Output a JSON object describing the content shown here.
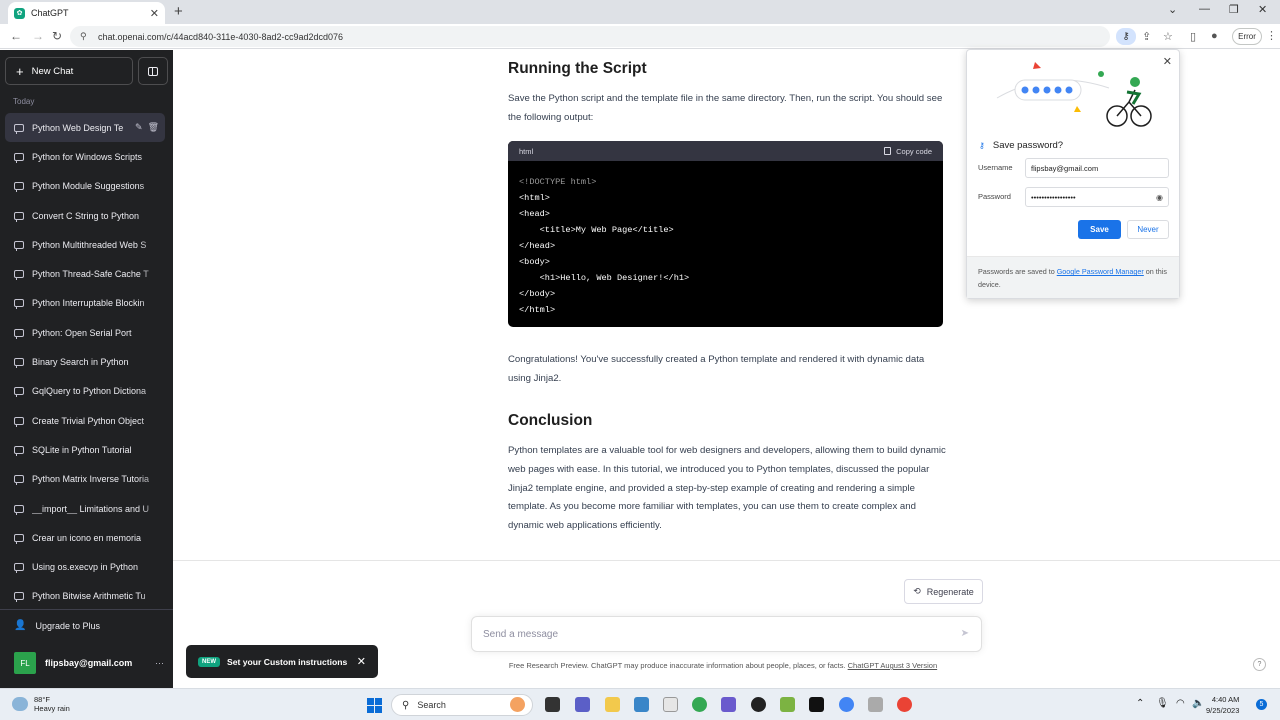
{
  "browser": {
    "tab_title": "ChatGPT",
    "url": "chat.openai.com/c/44acd840-311e-4030-8ad2-cc9ad2dcd076",
    "error_label": "Error"
  },
  "sidebar": {
    "new_chat": "New Chat",
    "section_today": "Today",
    "items": [
      {
        "label": "Python Web Design Te"
      },
      {
        "label": "Python for Windows Scripts"
      },
      {
        "label": "Python Module Suggestions"
      },
      {
        "label": "Convert C String to Python"
      },
      {
        "label": "Python Multithreaded Web S"
      },
      {
        "label": "Python Thread-Safe Cache T"
      },
      {
        "label": "Python Interruptable Blockin"
      },
      {
        "label": "Python: Open Serial Port"
      },
      {
        "label": "Binary Search in Python"
      },
      {
        "label": "GqlQuery to Python Dictiona"
      },
      {
        "label": "Create Trivial Python Object"
      },
      {
        "label": "SQLite in Python Tutorial"
      },
      {
        "label": "Python Matrix Inverse Tutoria"
      },
      {
        "label": "__import__ Limitations and U"
      },
      {
        "label": "Crear un icono en memoria"
      },
      {
        "label": "Using os.execvp in Python"
      },
      {
        "label": "Python Bitwise Arithmetic Tu"
      }
    ],
    "upgrade": "Upgrade to Plus",
    "account_initials": "FL",
    "account_email": "flipsbay@gmail.com"
  },
  "content": {
    "heading_running": "Running the Script",
    "para_running": "Save the Python script and the template file in the same directory. Then, run the script. You should see the following output:",
    "code_lang": "html",
    "copy_code": "Copy code",
    "code_lines": [
      "<!DOCTYPE html>",
      "<html>",
      "<head>",
      "    <title>My Web Page</title>",
      "</head>",
      "<body>",
      "    <h1>Hello, Web Designer!</h1>",
      "</body>",
      "</html>"
    ],
    "para_congrats": "Congratulations! You've successfully created a Python template and rendered it with dynamic data using Jinja2.",
    "heading_conclusion": "Conclusion",
    "para_conclusion": "Python templates are a valuable tool for web designers and developers, allowing them to build dynamic web pages with ease. In this tutorial, we introduced you to Python templates, discussed the popular Jinja2 template engine, and provided a step-by-step example of creating and rendering a simple template. As you become more familiar with templates, you can use them to create complex and dynamic web applications efficiently."
  },
  "composer": {
    "regenerate": "Regenerate",
    "placeholder": "Send a message",
    "disclaimer": "Free Research Preview. ChatGPT may produce inaccurate information about people, places, or facts.",
    "version_link": "ChatGPT August 3 Version",
    "help": "?"
  },
  "toast": {
    "badge": "NEW",
    "text": "Set your Custom instructions"
  },
  "password_popup": {
    "title": "Save password?",
    "username_label": "Username",
    "username_value": "flipsbay@gmail.com",
    "password_label": "Password",
    "password_value": "•••••••••••••••••",
    "save": "Save",
    "never": "Never",
    "footer_prefix": "Passwords are saved to ",
    "footer_link": "Google Password Manager",
    "footer_suffix": " on this device."
  },
  "taskbar": {
    "temperature": "88°F",
    "weather": "Heavy rain",
    "search": "Search",
    "time": "4:40 AM",
    "date": "9/25/2023",
    "notification_count": "5"
  },
  "colors": {
    "sidebar_bg": "#202123",
    "accent_green": "#10a37f",
    "chrome_blue": "#1a73e8",
    "code_bg": "#000000"
  }
}
